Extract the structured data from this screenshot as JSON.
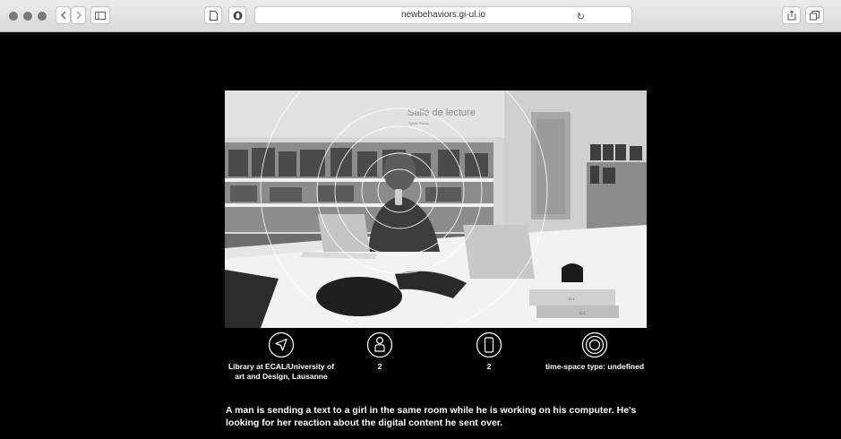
{
  "browser": {
    "url": "newbehaviors.gi-ul.io",
    "reload_icon": "reload-icon",
    "share_icon": "share-icon",
    "tabs_icon": "tabs-icon"
  },
  "photo": {
    "sign_title": "Salle de lecture",
    "sign_subtitle": "Sylvie Fleury",
    "box_label_1": "D-1",
    "box_label_2": "D-1"
  },
  "info": [
    {
      "icon": "location-arrow-icon",
      "text": "Library at ECAL/University of art and Design, Lausanne"
    },
    {
      "icon": "person-icon",
      "text": "2"
    },
    {
      "icon": "phone-icon",
      "text": "2"
    },
    {
      "icon": "time-space-icon",
      "text": "time-space type: undefined"
    }
  ],
  "caption": "A man is sending a text to a girl in the same room while he is working on his computer. He's looking for her reaction about the digital content he sent over."
}
